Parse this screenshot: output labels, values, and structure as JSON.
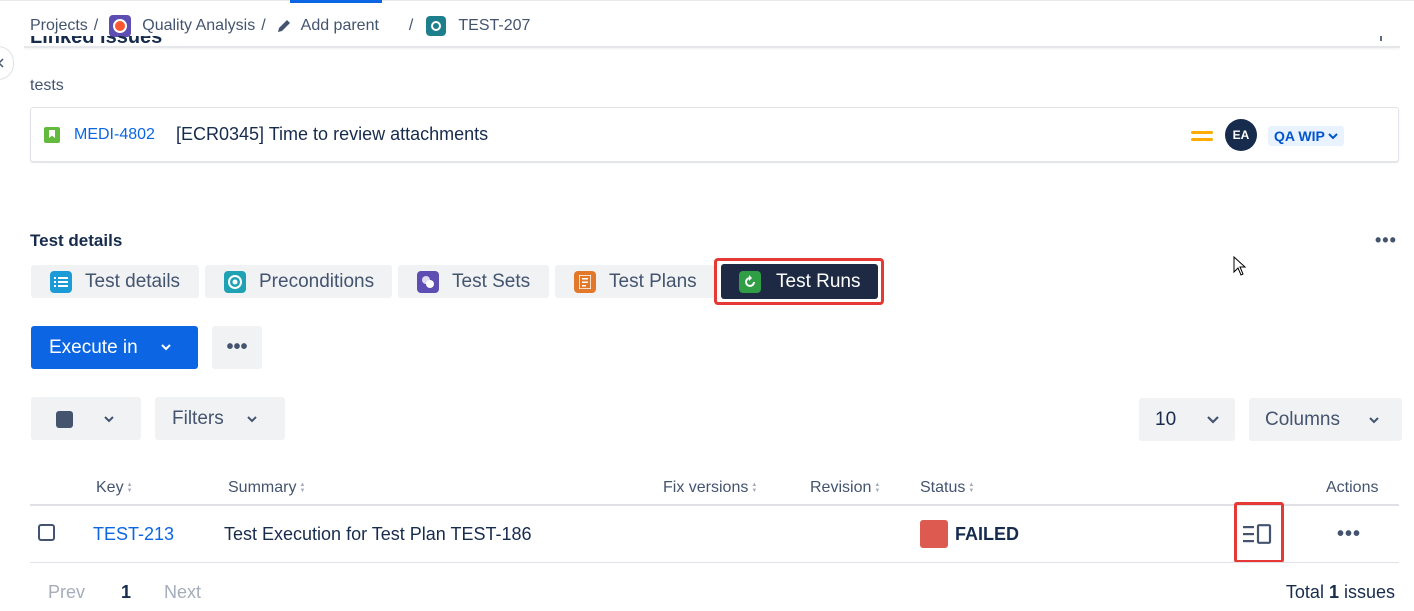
{
  "breadcrumb": {
    "projects": "Projects",
    "sep": "/",
    "project": "Quality Analysis",
    "add_parent": "Add parent",
    "issue": "TEST-207"
  },
  "linked_issues": {
    "title": "Linked issues",
    "add": "+",
    "relation": "tests",
    "items": [
      {
        "key": "MEDI-4802",
        "summary": "[ECR0345] Time to review attachments",
        "assignee_initials": "EA",
        "status": "QA WIP",
        "priority": "medium"
      }
    ]
  },
  "test_details": {
    "title": "Test details",
    "more": "•••",
    "tabs": [
      {
        "label": "Test details",
        "icon": "list-icon",
        "color": "#1d9bd7"
      },
      {
        "label": "Preconditions",
        "icon": "precondition-icon",
        "color": "#1fa2b4"
      },
      {
        "label": "Test Sets",
        "icon": "test-set-icon",
        "color": "#5e4db2"
      },
      {
        "label": "Test Plans",
        "icon": "test-plan-icon",
        "color": "#e2792a"
      },
      {
        "label": "Test Runs",
        "icon": "test-run-icon",
        "color": "#2f9e44",
        "active": true
      }
    ]
  },
  "toolbar": {
    "execute_label": "Execute in",
    "more": "•••",
    "filters_label": "Filters",
    "page_size": "10",
    "columns_label": "Columns"
  },
  "table": {
    "columns": [
      "Key",
      "Summary",
      "Fix versions",
      "Revision",
      "Status",
      "Actions"
    ],
    "rows": [
      {
        "key": "TEST-213",
        "summary": "Test Execution for Test Plan TEST-186",
        "fix_versions": "",
        "revision": "",
        "status": "FAILED",
        "status_color": "#dc5a4f",
        "actions": "•••"
      }
    ]
  },
  "pagination": {
    "prev": "Prev",
    "page": "1",
    "next": "Next",
    "total_prefix": "Total",
    "total_count": "1",
    "total_suffix": "issues"
  },
  "colors": {
    "primary": "#0c66e4",
    "active_tab": "#1e2a44",
    "highlight": "#e53935"
  }
}
